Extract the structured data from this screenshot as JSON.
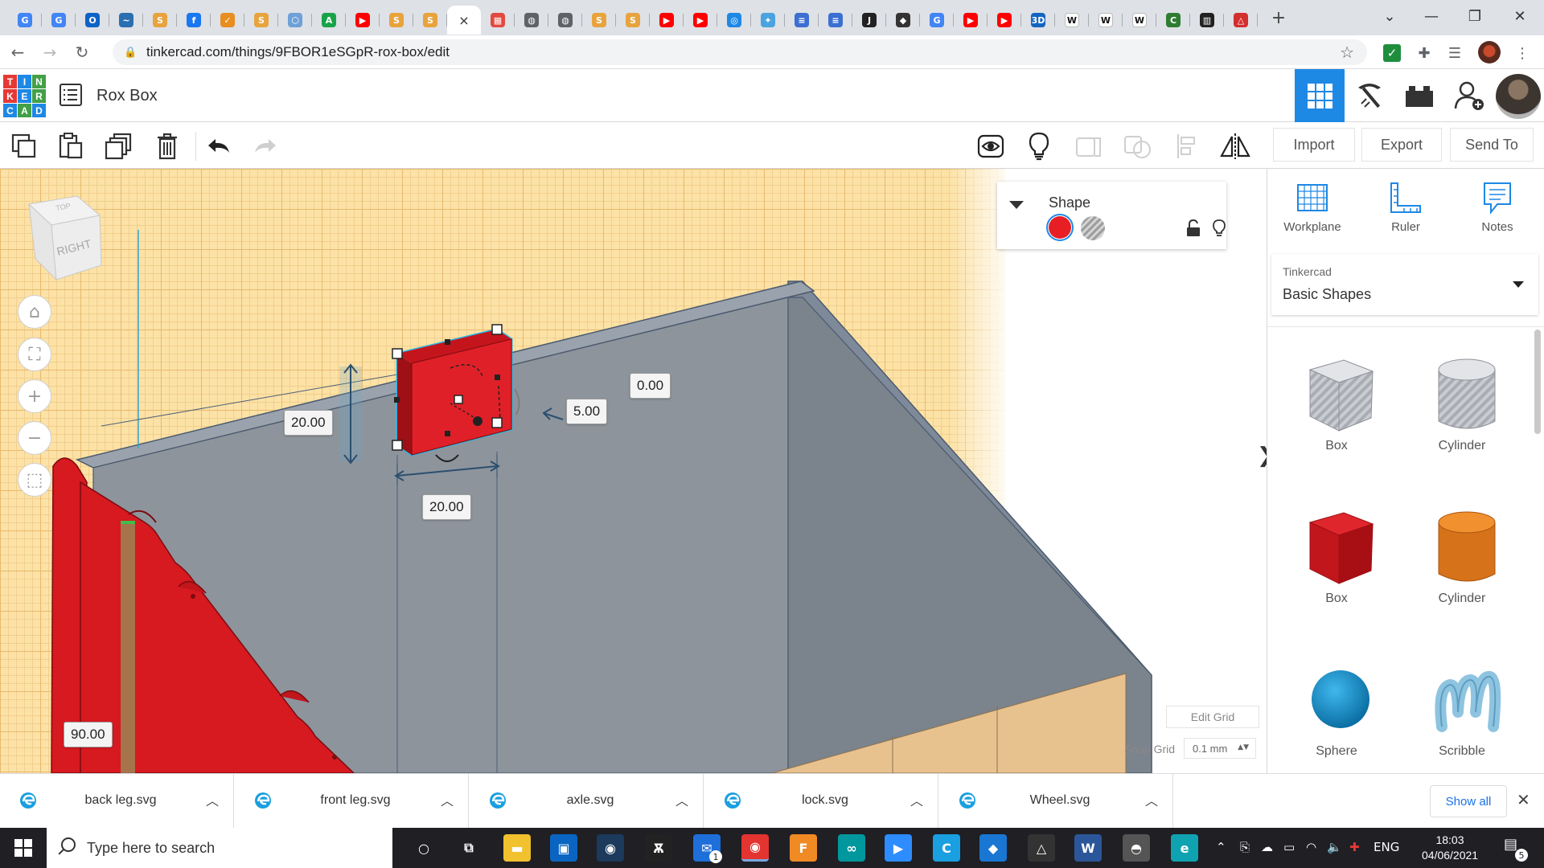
{
  "browser": {
    "tabs": [
      {
        "icon": "google-docs-icon",
        "color": "#4285f4",
        "glyph": "G"
      },
      {
        "icon": "google-docs-icon",
        "color": "#4285f4",
        "glyph": "G"
      },
      {
        "icon": "outlook-icon",
        "color": "#0f62c7",
        "glyph": "O"
      },
      {
        "icon": "bird-icon",
        "color": "#2a6fb0",
        "glyph": "~"
      },
      {
        "icon": "scratch-cat-icon",
        "color": "#e8a33d",
        "glyph": "S"
      },
      {
        "icon": "facebook-icon",
        "color": "#1877f2",
        "glyph": "f"
      },
      {
        "icon": "check-icon",
        "color": "#e88d1f",
        "glyph": "✓"
      },
      {
        "icon": "scratch-cat-icon",
        "color": "#e8a33d",
        "glyph": "S"
      },
      {
        "icon": "hexagon-icon",
        "color": "#6fa0d8",
        "glyph": "⬡"
      },
      {
        "icon": "artstation-icon",
        "color": "#18a34a",
        "glyph": "A"
      },
      {
        "icon": "youtube-icon",
        "color": "#ff0000",
        "glyph": "▶"
      },
      {
        "icon": "scratch-cat-icon",
        "color": "#e8a33d",
        "glyph": "S"
      },
      {
        "icon": "scratch-cat-icon",
        "color": "#e8a33d",
        "glyph": "S"
      },
      {
        "icon": "tinkercad-icon",
        "color": "#ffffff",
        "glyph": "×",
        "active": true
      },
      {
        "icon": "tinkercad-grid-icon",
        "color": "#e2493f",
        "glyph": "▦"
      },
      {
        "icon": "globe-icon",
        "color": "#5f6368",
        "glyph": "◍"
      },
      {
        "icon": "globe-icon",
        "color": "#5f6368",
        "glyph": "◍"
      },
      {
        "icon": "scratch-cat-icon",
        "color": "#e8a33d",
        "glyph": "S"
      },
      {
        "icon": "scratch-cat-icon",
        "color": "#e8a33d",
        "glyph": "S"
      },
      {
        "icon": "youtube-icon",
        "color": "#ff0000",
        "glyph": "▶"
      },
      {
        "icon": "youtube-icon",
        "color": "#ff0000",
        "glyph": "▶"
      },
      {
        "icon": "target-icon",
        "color": "#1e88e5",
        "glyph": "◎"
      },
      {
        "icon": "puzzle-icon",
        "color": "#4aa3df",
        "glyph": "✦"
      },
      {
        "icon": "stack-icon",
        "color": "#3b6fd1",
        "glyph": "≡"
      },
      {
        "icon": "stack-icon",
        "color": "#3b6fd1",
        "glyph": "≡"
      },
      {
        "icon": "script-icon",
        "color": "#222222",
        "glyph": "J"
      },
      {
        "icon": "raspberry-icon",
        "color": "#333333",
        "glyph": "◆"
      },
      {
        "icon": "google-icon",
        "color": "#4285f4",
        "glyph": "G"
      },
      {
        "icon": "youtube-icon",
        "color": "#ff0000",
        "glyph": "▶"
      },
      {
        "icon": "youtube-icon",
        "color": "#ff0000",
        "glyph": "▶"
      },
      {
        "icon": "three-d-icon",
        "color": "#1565c0",
        "glyph": "3D"
      },
      {
        "icon": "wikipedia-icon",
        "color": "#ffffff",
        "glyph": "W"
      },
      {
        "icon": "wikipedia-icon",
        "color": "#ffffff",
        "glyph": "W"
      },
      {
        "icon": "wikipedia-icon",
        "color": "#ffffff",
        "glyph": "W"
      },
      {
        "icon": "book-icon",
        "color": "#2e7d32",
        "glyph": "C"
      },
      {
        "icon": "barcode-icon",
        "color": "#222222",
        "glyph": "▥"
      },
      {
        "icon": "warning-icon",
        "color": "#d32f2f",
        "glyph": "△"
      }
    ],
    "url": "tinkercad.com/things/9FBOR1eSGpR-rox-box/edit"
  },
  "app": {
    "logo_letters": [
      "T",
      "I",
      "N",
      "K",
      "E",
      "R",
      "C",
      "A",
      "D"
    ],
    "logo_colors": [
      "#e53935",
      "#1e88e5",
      "#43a047",
      "#e53935",
      "#1e88e5",
      "#43a047",
      "#1e88e5",
      "#43a047",
      "#1e88e5"
    ],
    "design_title": "Rox Box",
    "header_icons": [
      "3d-view-icon",
      "pickaxe-icon",
      "bricks-icon",
      "add-user-icon"
    ]
  },
  "toolbar": {
    "import_label": "Import",
    "export_label": "Export",
    "send_to_label": "Send To"
  },
  "workspace": {
    "viewcube_face": "RIGHT",
    "dims": {
      "height": "20.00",
      "elevation": "0.00",
      "depth": "5.00",
      "width": "20.00",
      "rotation": "90.00"
    },
    "edit_grid_label": "Edit Grid",
    "snap_grid_label": "Snap Grid",
    "snap_grid_value": "0.1 mm",
    "grid_color": "#fce2a6",
    "selected_color": "#e81e25"
  },
  "inspector": {
    "title": "Shape",
    "solid_color": "#e81e25"
  },
  "panel": {
    "tools": [
      {
        "label": "Workplane",
        "icon": "workplane-icon"
      },
      {
        "label": "Ruler",
        "icon": "ruler-icon"
      },
      {
        "label": "Notes",
        "icon": "notes-icon"
      }
    ],
    "library_source": "Tinkercad",
    "library_name": "Basic Shapes",
    "shapes": [
      {
        "label": "Box",
        "kind": "box-hole"
      },
      {
        "label": "Cylinder",
        "kind": "cylinder-hole"
      },
      {
        "label": "Box",
        "kind": "box"
      },
      {
        "label": "Cylinder",
        "kind": "cylinder"
      },
      {
        "label": "Sphere",
        "kind": "sphere"
      },
      {
        "label": "Scribble",
        "kind": "scribble"
      }
    ]
  },
  "downloads": {
    "items": [
      {
        "name": "back leg.svg"
      },
      {
        "name": "front leg.svg"
      },
      {
        "name": "axle.svg"
      },
      {
        "name": "lock.svg"
      },
      {
        "name": "Wheel.svg"
      }
    ],
    "show_all_label": "Show all"
  },
  "taskbar": {
    "search_placeholder": "Type here to search",
    "apps": [
      {
        "icon": "cortana-icon",
        "color": "transparent",
        "glyph": "○"
      },
      {
        "icon": "task-view-icon",
        "color": "transparent",
        "glyph": "⧉"
      },
      {
        "icon": "file-explorer-icon",
        "color": "#f2c12e",
        "glyph": "▬"
      },
      {
        "icon": "store-icon",
        "color": "#0a65c2",
        "glyph": "▣"
      },
      {
        "icon": "steam-icon",
        "color": "#1b3a5c",
        "glyph": "◉"
      },
      {
        "icon": "alienware-icon",
        "color": "#222222",
        "glyph": "Ѫ"
      },
      {
        "icon": "mail-icon",
        "color": "#1e6fd9",
        "glyph": "✉"
      },
      {
        "icon": "chrome-icon",
        "color": "#e3342f",
        "glyph": "◉"
      },
      {
        "icon": "fusion-icon",
        "color": "#f08a24",
        "glyph": "F"
      },
      {
        "icon": "arduino-icon",
        "color": "#00979d",
        "glyph": "∞"
      },
      {
        "icon": "zoom-icon",
        "color": "#2d8cff",
        "glyph": "▶"
      },
      {
        "icon": "cura-icon",
        "color": "#1a9fe0",
        "glyph": "C"
      },
      {
        "icon": "kite-icon",
        "color": "#1976d2",
        "glyph": "◆"
      },
      {
        "icon": "inkscape-icon",
        "color": "#333333",
        "glyph": "△"
      },
      {
        "icon": "word-icon",
        "color": "#2b579a",
        "glyph": "W"
      },
      {
        "icon": "hat-icon",
        "color": "#555555",
        "glyph": "◓"
      },
      {
        "icon": "edge-icon",
        "color": "#0fa3b1",
        "glyph": "e"
      }
    ],
    "language": "ENG",
    "time": "18:03",
    "date": "04/06/2021",
    "notification_count": "5",
    "mail_badge": "1"
  }
}
